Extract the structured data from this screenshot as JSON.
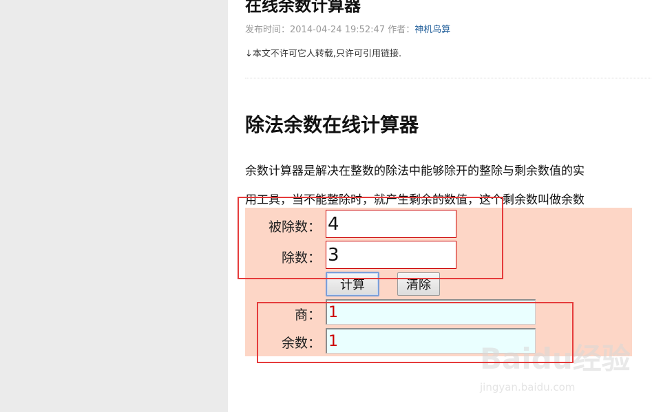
{
  "article": {
    "title": "在线余数计算器",
    "meta": {
      "published_label": "发布时间：",
      "published_time": "2014-04-24 19:52:47",
      "author_label": "作者：",
      "author": "神机鸟算"
    },
    "notice": "↓本文不许可它人转载,只许可引用链接."
  },
  "section": {
    "heading": "除法余数在线计算器",
    "paragraph_line1": "余数计算器是解决在整数的除法中能够除开的整除与剩余数值的实",
    "paragraph_line2": "用工具，当不能整除时，就产生剩余的数值，这个剩余数叫做余数"
  },
  "calculator": {
    "dividend_label": "被除数：",
    "dividend_value": "4",
    "divisor_label": "除数：",
    "divisor_value": "3",
    "calculate_label": "计算",
    "clear_label": "清除",
    "quotient_label": "商：",
    "quotient_value": "1",
    "remainder_label": "余数：",
    "remainder_value": "1"
  },
  "watermark": {
    "brand": "Baidu经验",
    "url": "jingyan.baidu.com"
  },
  "colors": {
    "panel_background": "#fdd6c6",
    "annotation_red": "#e53b3b",
    "result_text_red": "#cc0000",
    "result_background": "#eaffff",
    "author_link": "#1f5d99"
  }
}
